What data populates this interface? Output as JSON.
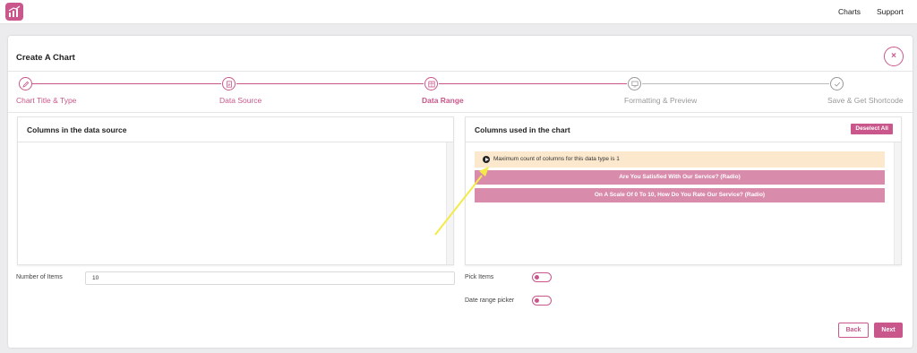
{
  "nav": {
    "charts": "Charts",
    "support": "Support"
  },
  "page": {
    "title": "Create A Chart",
    "close_label": "×"
  },
  "steps": [
    {
      "label": "Chart Title & Type",
      "state": "done",
      "icon": "pencil-icon"
    },
    {
      "label": "Data Source",
      "state": "done",
      "icon": "document-icon"
    },
    {
      "label": "Data Range",
      "state": "current",
      "icon": "table-icon"
    },
    {
      "label": "Formatting & Preview",
      "state": "todo",
      "icon": "monitor-icon"
    },
    {
      "label": "Save & Get Shortcode",
      "state": "todo",
      "icon": "checkmark-icon"
    }
  ],
  "left_panel": {
    "title": "Columns in the data source",
    "columns": []
  },
  "right_panel": {
    "title": "Columns used in the chart",
    "deselect_label": "Deselect All",
    "notice": "Maximum count of columns for this data type is 1",
    "columns": [
      "Are You Satisfied With Our Service? (Radio)",
      "On A Scale Of 0 To 10, How Do You Rate Our Service? (Radio)"
    ]
  },
  "fields": {
    "number_of_items_label": "Number of Items",
    "number_of_items_value": "10",
    "pick_items_label": "Pick Items",
    "pick_items_enabled": false,
    "date_range_label": "Date range picker",
    "date_range_enabled": false
  },
  "buttons": {
    "back": "Back",
    "next": "Next"
  },
  "colors": {
    "accent": "#c9578b",
    "accent_light": "#d98bab",
    "notice_bg": "#fbe8cd",
    "annotation_arrow": "#f3ea4a"
  }
}
